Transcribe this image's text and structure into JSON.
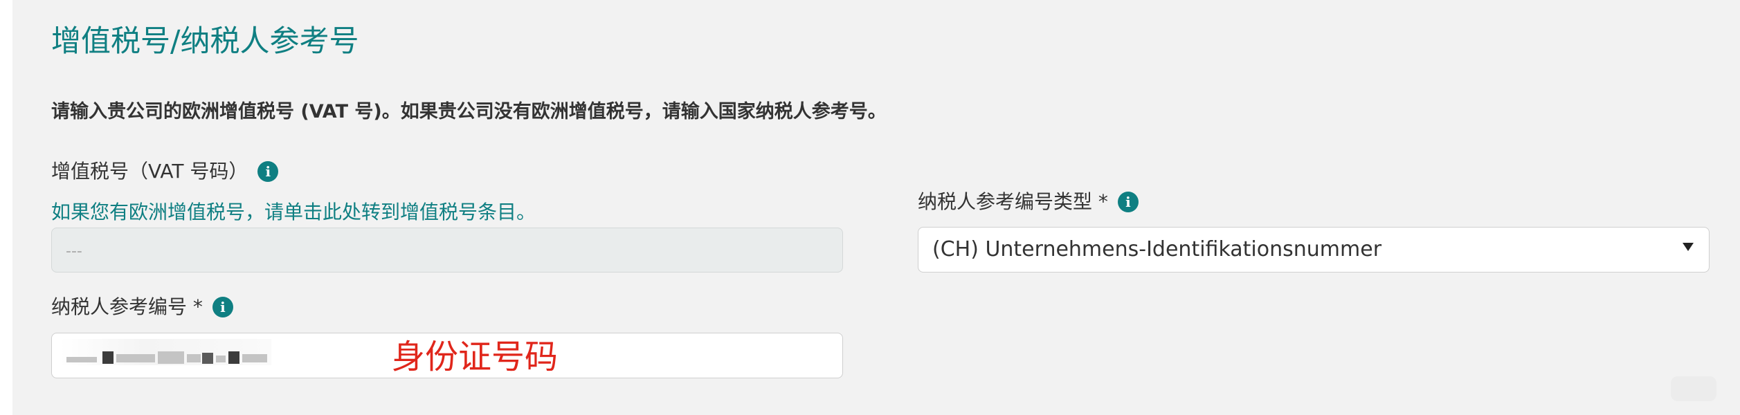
{
  "section": {
    "title": "增值税号/纳税人参考号",
    "instruction": "请输入贵公司的欧洲增值税号 (VAT 号)。如果贵公司没有欧洲增值税号，请输入国家纳税人参考号。"
  },
  "vat_field": {
    "label": "增值税号（VAT 号码）",
    "link_text": "如果您有欧洲增值税号，请单击此处转到增值税号条目。",
    "placeholder": "---"
  },
  "tax_ref_type_field": {
    "label": "纳税人参考编号类型 *",
    "selected_value": "(CH) Unternehmens-Identifikationsnummer"
  },
  "tax_ref_field": {
    "label": "纳税人参考编号 *"
  },
  "annotation": {
    "text": "身份证号码",
    "color": "#e0261b"
  },
  "icons": {
    "info": "info-icon",
    "dropdown": "caret-down-icon"
  },
  "colors": {
    "accent": "#0f7f82",
    "panel_background": "#f2f2f2"
  }
}
